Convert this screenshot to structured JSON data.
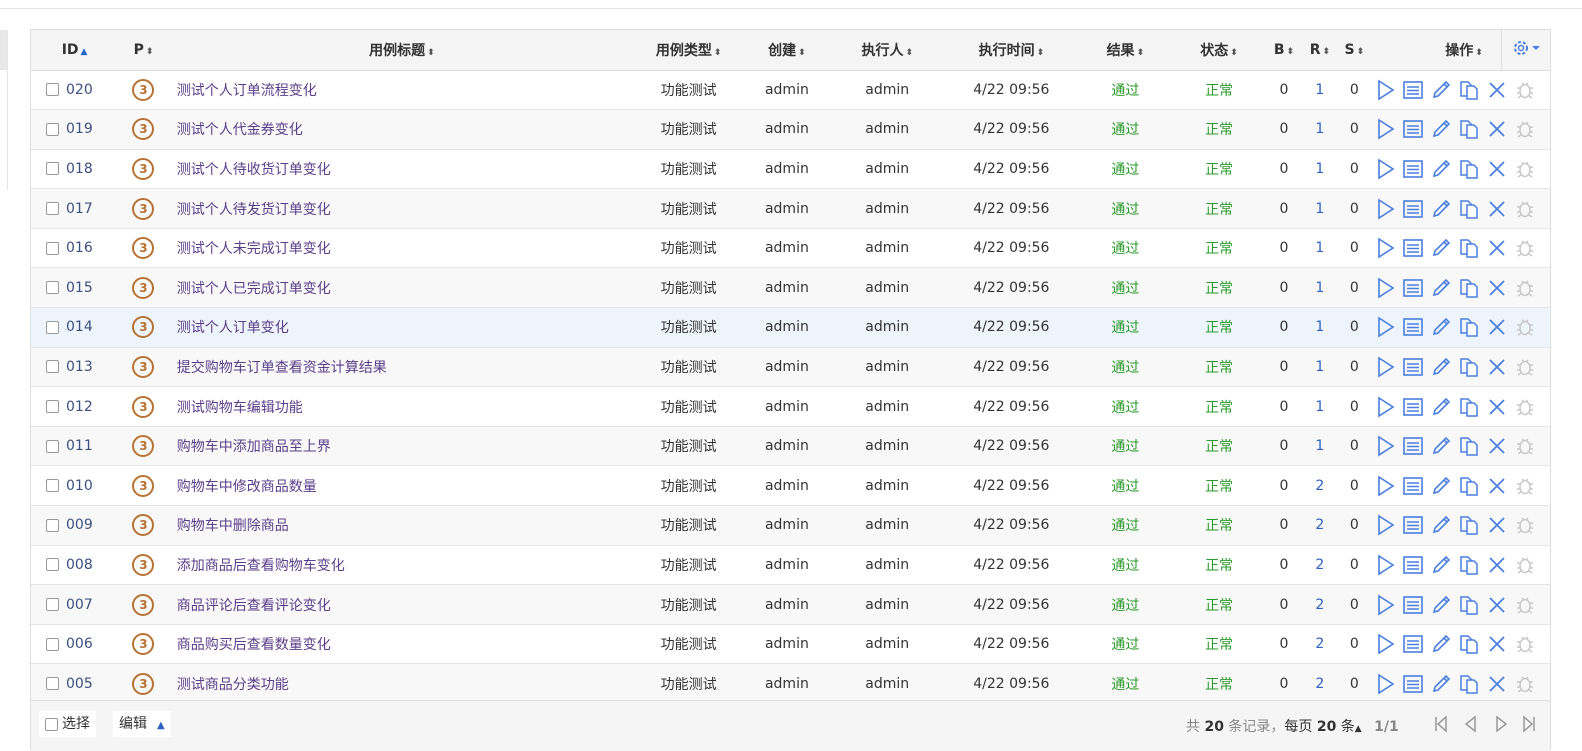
{
  "columns": {
    "id": "ID",
    "priority": "P",
    "title": "用例标题",
    "type": "用例类型",
    "creator": "创建",
    "executor": "执行人",
    "exec_time": "执行时间",
    "result": "结果",
    "status": "状态",
    "b": "B",
    "r": "R",
    "s": "S",
    "actions": "操作"
  },
  "rows": [
    {
      "id": "020",
      "priority": "3",
      "title": "测试个人订单流程变化",
      "type": "功能测试",
      "creator": "admin",
      "executor": "admin",
      "time": "4/22 09:56",
      "result": "通过",
      "status": "正常",
      "b": "0",
      "r": "1",
      "s": "0"
    },
    {
      "id": "019",
      "priority": "3",
      "title": "测试个人代金券变化",
      "type": "功能测试",
      "creator": "admin",
      "executor": "admin",
      "time": "4/22 09:56",
      "result": "通过",
      "status": "正常",
      "b": "0",
      "r": "1",
      "s": "0"
    },
    {
      "id": "018",
      "priority": "3",
      "title": "测试个人待收货订单变化",
      "type": "功能测试",
      "creator": "admin",
      "executor": "admin",
      "time": "4/22 09:56",
      "result": "通过",
      "status": "正常",
      "b": "0",
      "r": "1",
      "s": "0"
    },
    {
      "id": "017",
      "priority": "3",
      "title": "测试个人待发货订单变化",
      "type": "功能测试",
      "creator": "admin",
      "executor": "admin",
      "time": "4/22 09:56",
      "result": "通过",
      "status": "正常",
      "b": "0",
      "r": "1",
      "s": "0"
    },
    {
      "id": "016",
      "priority": "3",
      "title": "测试个人未完成订单变化",
      "type": "功能测试",
      "creator": "admin",
      "executor": "admin",
      "time": "4/22 09:56",
      "result": "通过",
      "status": "正常",
      "b": "0",
      "r": "1",
      "s": "0"
    },
    {
      "id": "015",
      "priority": "3",
      "title": "测试个人已完成订单变化",
      "type": "功能测试",
      "creator": "admin",
      "executor": "admin",
      "time": "4/22 09:56",
      "result": "通过",
      "status": "正常",
      "b": "0",
      "r": "1",
      "s": "0"
    },
    {
      "id": "014",
      "priority": "3",
      "title": "测试个人订单变化",
      "type": "功能测试",
      "creator": "admin",
      "executor": "admin",
      "time": "4/22 09:56",
      "result": "通过",
      "status": "正常",
      "b": "0",
      "r": "1",
      "s": "0"
    },
    {
      "id": "013",
      "priority": "3",
      "title": "提交购物车订单查看资金计算结果",
      "type": "功能测试",
      "creator": "admin",
      "executor": "admin",
      "time": "4/22 09:56",
      "result": "通过",
      "status": "正常",
      "b": "0",
      "r": "1",
      "s": "0"
    },
    {
      "id": "012",
      "priority": "3",
      "title": "测试购物车编辑功能",
      "type": "功能测试",
      "creator": "admin",
      "executor": "admin",
      "time": "4/22 09:56",
      "result": "通过",
      "status": "正常",
      "b": "0",
      "r": "1",
      "s": "0"
    },
    {
      "id": "011",
      "priority": "3",
      "title": "购物车中添加商品至上界",
      "type": "功能测试",
      "creator": "admin",
      "executor": "admin",
      "time": "4/22 09:56",
      "result": "通过",
      "status": "正常",
      "b": "0",
      "r": "1",
      "s": "0"
    },
    {
      "id": "010",
      "priority": "3",
      "title": "购物车中修改商品数量",
      "type": "功能测试",
      "creator": "admin",
      "executor": "admin",
      "time": "4/22 09:56",
      "result": "通过",
      "status": "正常",
      "b": "0",
      "r": "2",
      "s": "0"
    },
    {
      "id": "009",
      "priority": "3",
      "title": "购物车中删除商品",
      "type": "功能测试",
      "creator": "admin",
      "executor": "admin",
      "time": "4/22 09:56",
      "result": "通过",
      "status": "正常",
      "b": "0",
      "r": "2",
      "s": "0"
    },
    {
      "id": "008",
      "priority": "3",
      "title": "添加商品后查看购物车变化",
      "type": "功能测试",
      "creator": "admin",
      "executor": "admin",
      "time": "4/22 09:56",
      "result": "通过",
      "status": "正常",
      "b": "0",
      "r": "2",
      "s": "0"
    },
    {
      "id": "007",
      "priority": "3",
      "title": "商品评论后查看评论变化",
      "type": "功能测试",
      "creator": "admin",
      "executor": "admin",
      "time": "4/22 09:56",
      "result": "通过",
      "status": "正常",
      "b": "0",
      "r": "2",
      "s": "0"
    },
    {
      "id": "006",
      "priority": "3",
      "title": "商品购买后查看数量变化",
      "type": "功能测试",
      "creator": "admin",
      "executor": "admin",
      "time": "4/22 09:56",
      "result": "通过",
      "status": "正常",
      "b": "0",
      "r": "2",
      "s": "0"
    },
    {
      "id": "005",
      "priority": "3",
      "title": "测试商品分类功能",
      "type": "功能测试",
      "creator": "admin",
      "executor": "admin",
      "time": "4/22 09:56",
      "result": "通过",
      "status": "正常",
      "b": "0",
      "r": "2",
      "s": "0"
    }
  ],
  "row_actions": [
    "run-icon",
    "results-icon",
    "edit-icon",
    "copy-icon",
    "delete-icon",
    "bug-icon"
  ],
  "footer": {
    "select_label": "选择",
    "edit_label": "编辑",
    "total_prefix": "共",
    "total_count": "20",
    "total_suffix": "条记录，",
    "per_page_prefix": "每页",
    "per_page": "20",
    "per_page_suffix": "条",
    "page_indicator": "1/1"
  },
  "colors": {
    "accent": "#2d62c2",
    "pass": "#2a9b2a",
    "priority": "#b87333",
    "title_link": "#5b3e8a",
    "icon_blue": "#4a7fe0",
    "icon_disabled": "#c8c8c8"
  }
}
